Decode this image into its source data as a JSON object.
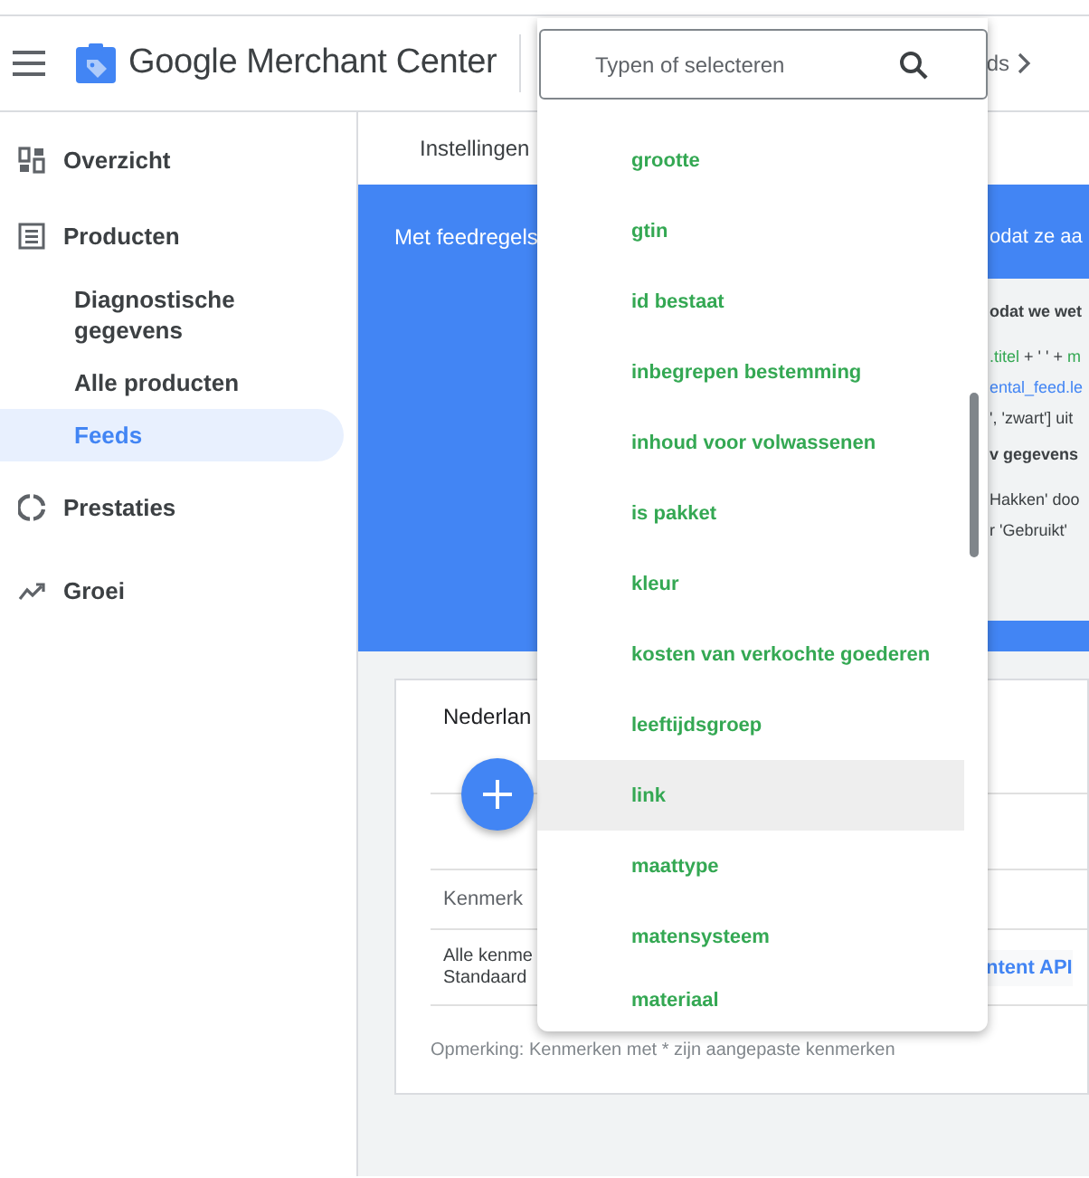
{
  "header": {
    "title": "Google Merchant Center",
    "breadcrumb": "ds"
  },
  "sidebar": {
    "items": [
      {
        "label": "Overzicht",
        "kind": "dashboard",
        "selected": false
      },
      {
        "label": "Producten",
        "kind": "list",
        "selected": false,
        "children": [
          {
            "label": "Diagnostische gegevens",
            "selected": false
          },
          {
            "label": "Alle producten",
            "selected": false
          },
          {
            "label": "Feeds",
            "selected": true
          }
        ]
      },
      {
        "label": "Prestaties",
        "kind": "ring",
        "selected": false
      },
      {
        "label": "Groei",
        "kind": "trend",
        "selected": false
      }
    ]
  },
  "tabs": [
    {
      "label": "Instellingen"
    }
  ],
  "banner": {
    "text": "Met feedregels",
    "text_right": "odat ze aa",
    "panel": {
      "sections": [
        {
          "heading": "odat we wet",
          "lines": [
            [
              {
                "text": ".titel",
                "kind": "attribute"
              },
              {
                "text": " + ' ' + ",
                "kind": "plain"
              },
              {
                "text": "m",
                "kind": "attribute"
              }
            ],
            [
              {
                "text": "ental_feed.le",
                "kind": "source"
              }
            ],
            [
              {
                "text": "', 'zwart'] uit",
                "kind": "plain"
              }
            ]
          ]
        },
        {
          "heading": "v gegevens",
          "lines": [
            [
              {
                "text": "Hakken' doo",
                "kind": "plain"
              }
            ],
            [
              {
                "text": "r 'Gebruikt'",
                "kind": "plain"
              }
            ]
          ]
        }
      ]
    }
  },
  "card": {
    "title": "Nederlan",
    "table": {
      "columns": [
        "Kenmerk"
      ],
      "rows": [
        {
          "cells": [
            "Alle kenme",
            "Standaard"
          ],
          "source": "ntent API"
        }
      ]
    },
    "note": "Opmerking: Kenmerken met * zijn aangepaste kenmerken"
  },
  "dropdown": {
    "placeholder": "Typen of selecteren",
    "options": [
      {
        "label": "grootte",
        "selected": false
      },
      {
        "label": "gtin",
        "selected": false
      },
      {
        "label": "id bestaat",
        "selected": false
      },
      {
        "label": "inbegrepen bestemming",
        "selected": false
      },
      {
        "label": "inhoud voor volwassenen",
        "selected": false
      },
      {
        "label": "is pakket",
        "selected": false
      },
      {
        "label": "kleur",
        "selected": false
      },
      {
        "label": "kosten van verkochte goederen",
        "selected": false
      },
      {
        "label": "leeftijdsgroep",
        "selected": false
      },
      {
        "label": "link",
        "selected": true
      },
      {
        "label": "maattype",
        "selected": false
      },
      {
        "label": "matensysteem",
        "selected": false
      },
      {
        "label": "materiaal",
        "selected": false
      }
    ]
  }
}
